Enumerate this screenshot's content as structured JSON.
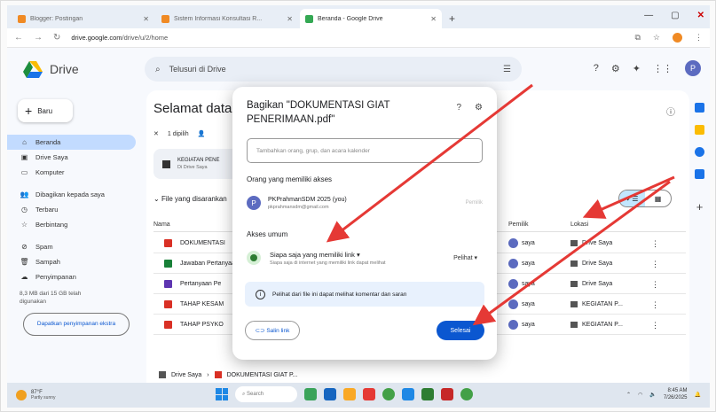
{
  "browser": {
    "tabs": [
      {
        "label": "Blogger: Postingan",
        "color": "#f08a24"
      },
      {
        "label": "Sistem Informasi Konsultasi R...",
        "color": "#f08a24"
      },
      {
        "label": "Beranda - Google Drive",
        "color": "#34a853"
      }
    ],
    "url_host": "drive.google.com",
    "url_path": "/drive/u/2/home"
  },
  "header": {
    "app_name": "Drive",
    "search_placeholder": "Telusuri di Drive",
    "avatar_letter": "P"
  },
  "sidebar": {
    "new_label": "Baru",
    "items": [
      {
        "label": "Beranda",
        "icon": "home-icon"
      },
      {
        "label": "Drive Saya",
        "icon": "drive-icon"
      },
      {
        "label": "Komputer",
        "icon": "computer-icon"
      },
      {
        "label": "Dibagikan kepada saya",
        "icon": "shared-icon"
      },
      {
        "label": "Terbaru",
        "icon": "clock-icon"
      },
      {
        "label": "Berbintang",
        "icon": "star-icon"
      },
      {
        "label": "Spam",
        "icon": "spam-icon"
      },
      {
        "label": "Sampah",
        "icon": "trash-icon"
      },
      {
        "label": "Penyimpanan",
        "icon": "cloud-icon"
      }
    ],
    "storage_text": "8,3 MB dari 15 GB telah digunakan",
    "storage_button": "Dapatkan penyimpanan ekstra"
  },
  "main": {
    "title": "Selamat datang",
    "selected": "1 dipilih",
    "suggestion": {
      "name": "KEGIATAN PENE",
      "location": "Di Drive Saya"
    },
    "section_label": "File yang disarankan",
    "columns": {
      "name": "Nama",
      "owner": "Pemilik",
      "location": "Lokasi"
    },
    "rows": [
      {
        "name": "DOKUMENTASI",
        "owner": "saya",
        "location": "Drive Saya",
        "color": "#d93025"
      },
      {
        "name": "Jawaban Pertanyaan",
        "owner": "saya",
        "location": "Drive Saya",
        "color": "#188038"
      },
      {
        "name": "Pertanyaan Pe",
        "owner": "saya",
        "location": "Drive Saya",
        "color": "#5e35b1"
      },
      {
        "name": "TAHAP KESAM",
        "owner": "saya",
        "location": "KEGIATAN P...",
        "color": "#d93025"
      },
      {
        "name": "TAHAP PSYKO",
        "owner": "saya",
        "location": "KEGIATAN P...",
        "color": "#d93025"
      }
    ],
    "breadcrumb_root": "Drive Saya",
    "breadcrumb_file": "DOKUMENTASI GIAT P..."
  },
  "share_dialog": {
    "title": "Bagikan \"DOKUMENTASI GIAT PENERIMAAN.pdf\"",
    "add_placeholder": "Tambahkan orang, grup, dan acara kalender",
    "people_heading": "Orang yang memiliki akses",
    "person": {
      "name": "PKPrahmanSDM 2025 (you)",
      "email": "pkprahmansdm@gmail.com",
      "role": "Pemilik",
      "initial": "P"
    },
    "general_heading": "Akses umum",
    "access_main": "Siapa saja yang memiliki link",
    "access_sub": "Siapa saja di internet yang memiliki link dapat melihat",
    "access_role": "Pelihat",
    "note": "Pelihat dari file ini dapat melihat komentar dan saran",
    "copy_link": "Salin link",
    "done": "Selesai"
  },
  "taskbar": {
    "temp": "87°F",
    "weather": "Partly sunny",
    "search": "Search",
    "time": "8:45 AM",
    "date": "7/26/2025"
  },
  "colors": {
    "accent": "#0b57d0",
    "arrow": "#e53935",
    "selected_nav": "#c2dbff"
  }
}
